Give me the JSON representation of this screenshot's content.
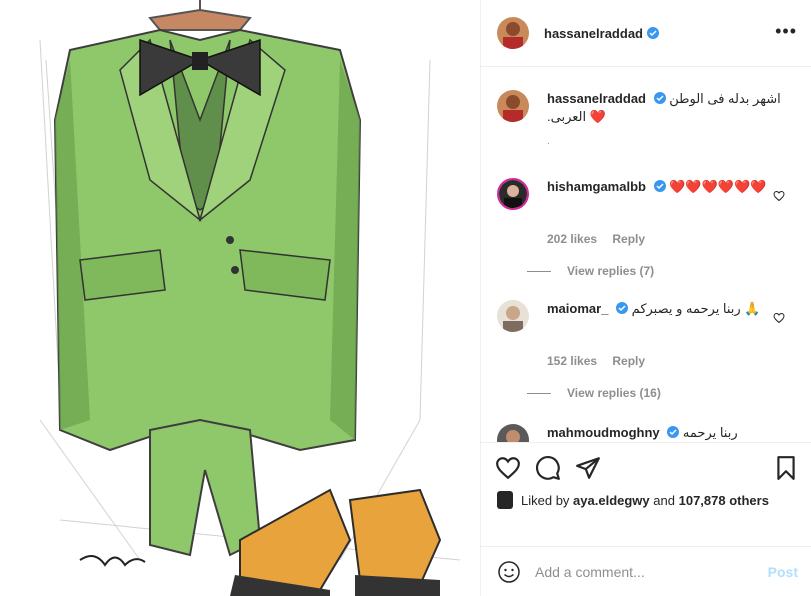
{
  "post": {
    "author": "hassanelraddad",
    "caption": "اشهر بدله فى الوطن العربى.",
    "caption_emoji": "❤️",
    "caption_dot": "."
  },
  "comments": [
    {
      "username": "hishamgamalbb",
      "text": "❤️❤️❤️❤️❤️❤️",
      "likes": "202 likes",
      "reply": "Reply",
      "view_replies": "View replies (7)",
      "verified": true
    },
    {
      "username": "maiomar_",
      "text": "ربنا يرحمه و يصبركم 🙏",
      "likes": "152 likes",
      "reply": "Reply",
      "view_replies": "View replies (16)",
      "verified": true
    },
    {
      "username": "mahmoudmoghny",
      "text": "ربنا يرحمه",
      "verified": true
    }
  ],
  "actions": {
    "liked_prefix": "Liked by",
    "liked_user": "aya.eldegwy",
    "liked_and": "and",
    "liked_count": "107,878 others"
  },
  "add_comment": {
    "placeholder": "Add a comment...",
    "post_label": "Post"
  },
  "colors": {
    "verified_blue": "#3897f0",
    "text": "#262626",
    "muted": "#8e8e8e",
    "post_disabled": "#b2dffc",
    "heart_red": "#ed4956",
    "suit_green": "#8fc86a",
    "shoe_orange": "#e8a33d"
  },
  "icons": [
    "more-icon",
    "verified-icon",
    "heart-icon",
    "comment-icon",
    "share-icon",
    "bookmark-icon",
    "smile-icon"
  ]
}
